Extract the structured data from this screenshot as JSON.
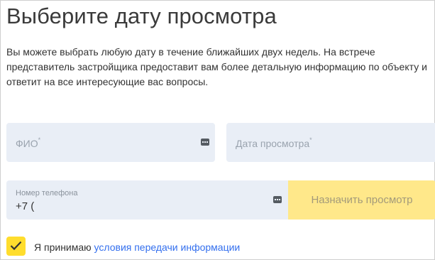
{
  "title": "Выберите дату просмотра",
  "description": "Вы можете выбрать любую дату в течение ближайших двух недель. На встрече представитель застройщика предоставит вам более детальную информацию по объекту и ответит на все интересующие вас вопросы.",
  "form": {
    "fio": {
      "placeholder": "ФИО",
      "required_mark": "*",
      "icon": "ellipsis-icon"
    },
    "date": {
      "placeholder": "Дата просмотра",
      "required_mark": "*"
    },
    "phone": {
      "label": "Номер телефона",
      "value": "+7 (",
      "icon": "ellipsis-icon"
    },
    "submit_label": "Назначить просмотр"
  },
  "consent": {
    "checked": true,
    "prefix": "Я принимаю",
    "link": "условия передачи информации"
  },
  "colors": {
    "accent_yellow": "#ffdd2d",
    "button_yellow_disabled": "#ffe88a",
    "field_bg": "#e9eef6",
    "link_blue": "#336fee"
  }
}
